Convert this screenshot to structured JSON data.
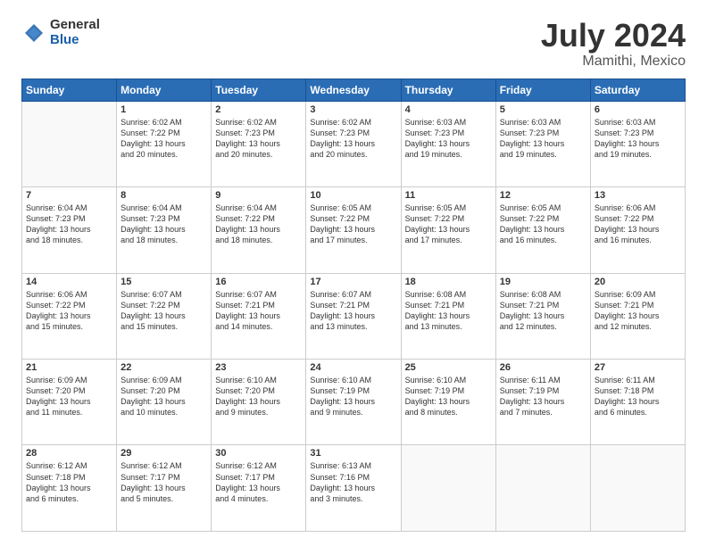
{
  "header": {
    "logo_general": "General",
    "logo_blue": "Blue",
    "title": "July 2024",
    "subtitle": "Mamithi, Mexico"
  },
  "days_header": [
    "Sunday",
    "Monday",
    "Tuesday",
    "Wednesday",
    "Thursday",
    "Friday",
    "Saturday"
  ],
  "weeks": [
    [
      {
        "day": "",
        "info": ""
      },
      {
        "day": "1",
        "info": "Sunrise: 6:02 AM\nSunset: 7:22 PM\nDaylight: 13 hours\nand 20 minutes."
      },
      {
        "day": "2",
        "info": "Sunrise: 6:02 AM\nSunset: 7:23 PM\nDaylight: 13 hours\nand 20 minutes."
      },
      {
        "day": "3",
        "info": "Sunrise: 6:02 AM\nSunset: 7:23 PM\nDaylight: 13 hours\nand 20 minutes."
      },
      {
        "day": "4",
        "info": "Sunrise: 6:03 AM\nSunset: 7:23 PM\nDaylight: 13 hours\nand 19 minutes."
      },
      {
        "day": "5",
        "info": "Sunrise: 6:03 AM\nSunset: 7:23 PM\nDaylight: 13 hours\nand 19 minutes."
      },
      {
        "day": "6",
        "info": "Sunrise: 6:03 AM\nSunset: 7:23 PM\nDaylight: 13 hours\nand 19 minutes."
      }
    ],
    [
      {
        "day": "7",
        "info": "Sunrise: 6:04 AM\nSunset: 7:23 PM\nDaylight: 13 hours\nand 18 minutes."
      },
      {
        "day": "8",
        "info": "Sunrise: 6:04 AM\nSunset: 7:23 PM\nDaylight: 13 hours\nand 18 minutes."
      },
      {
        "day": "9",
        "info": "Sunrise: 6:04 AM\nSunset: 7:22 PM\nDaylight: 13 hours\nand 18 minutes."
      },
      {
        "day": "10",
        "info": "Sunrise: 6:05 AM\nSunset: 7:22 PM\nDaylight: 13 hours\nand 17 minutes."
      },
      {
        "day": "11",
        "info": "Sunrise: 6:05 AM\nSunset: 7:22 PM\nDaylight: 13 hours\nand 17 minutes."
      },
      {
        "day": "12",
        "info": "Sunrise: 6:05 AM\nSunset: 7:22 PM\nDaylight: 13 hours\nand 16 minutes."
      },
      {
        "day": "13",
        "info": "Sunrise: 6:06 AM\nSunset: 7:22 PM\nDaylight: 13 hours\nand 16 minutes."
      }
    ],
    [
      {
        "day": "14",
        "info": "Sunrise: 6:06 AM\nSunset: 7:22 PM\nDaylight: 13 hours\nand 15 minutes."
      },
      {
        "day": "15",
        "info": "Sunrise: 6:07 AM\nSunset: 7:22 PM\nDaylight: 13 hours\nand 15 minutes."
      },
      {
        "day": "16",
        "info": "Sunrise: 6:07 AM\nSunset: 7:21 PM\nDaylight: 13 hours\nand 14 minutes."
      },
      {
        "day": "17",
        "info": "Sunrise: 6:07 AM\nSunset: 7:21 PM\nDaylight: 13 hours\nand 13 minutes."
      },
      {
        "day": "18",
        "info": "Sunrise: 6:08 AM\nSunset: 7:21 PM\nDaylight: 13 hours\nand 13 minutes."
      },
      {
        "day": "19",
        "info": "Sunrise: 6:08 AM\nSunset: 7:21 PM\nDaylight: 13 hours\nand 12 minutes."
      },
      {
        "day": "20",
        "info": "Sunrise: 6:09 AM\nSunset: 7:21 PM\nDaylight: 13 hours\nand 12 minutes."
      }
    ],
    [
      {
        "day": "21",
        "info": "Sunrise: 6:09 AM\nSunset: 7:20 PM\nDaylight: 13 hours\nand 11 minutes."
      },
      {
        "day": "22",
        "info": "Sunrise: 6:09 AM\nSunset: 7:20 PM\nDaylight: 13 hours\nand 10 minutes."
      },
      {
        "day": "23",
        "info": "Sunrise: 6:10 AM\nSunset: 7:20 PM\nDaylight: 13 hours\nand 9 minutes."
      },
      {
        "day": "24",
        "info": "Sunrise: 6:10 AM\nSunset: 7:19 PM\nDaylight: 13 hours\nand 9 minutes."
      },
      {
        "day": "25",
        "info": "Sunrise: 6:10 AM\nSunset: 7:19 PM\nDaylight: 13 hours\nand 8 minutes."
      },
      {
        "day": "26",
        "info": "Sunrise: 6:11 AM\nSunset: 7:19 PM\nDaylight: 13 hours\nand 7 minutes."
      },
      {
        "day": "27",
        "info": "Sunrise: 6:11 AM\nSunset: 7:18 PM\nDaylight: 13 hours\nand 6 minutes."
      }
    ],
    [
      {
        "day": "28",
        "info": "Sunrise: 6:12 AM\nSunset: 7:18 PM\nDaylight: 13 hours\nand 6 minutes."
      },
      {
        "day": "29",
        "info": "Sunrise: 6:12 AM\nSunset: 7:17 PM\nDaylight: 13 hours\nand 5 minutes."
      },
      {
        "day": "30",
        "info": "Sunrise: 6:12 AM\nSunset: 7:17 PM\nDaylight: 13 hours\nand 4 minutes."
      },
      {
        "day": "31",
        "info": "Sunrise: 6:13 AM\nSunset: 7:16 PM\nDaylight: 13 hours\nand 3 minutes."
      },
      {
        "day": "",
        "info": ""
      },
      {
        "day": "",
        "info": ""
      },
      {
        "day": "",
        "info": ""
      }
    ]
  ]
}
